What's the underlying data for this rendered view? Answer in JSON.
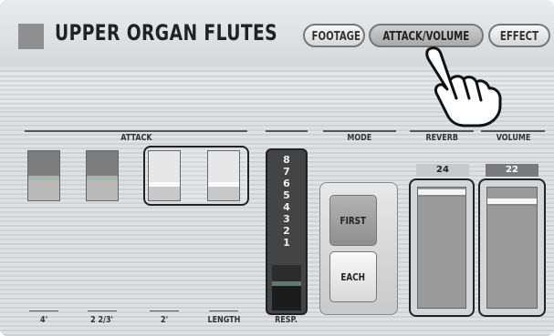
{
  "header": {
    "title": "UPPER ORGAN FLUTES",
    "tabs": [
      {
        "label": "FOOTAGE",
        "active": false
      },
      {
        "label": "ATTACK/VOLUME",
        "active": true
      },
      {
        "label": "EFFECT",
        "active": false
      }
    ]
  },
  "sections": {
    "attack": "ATTACK",
    "mode": "MODE",
    "reverb": "REVERB",
    "volume": "VOLUME"
  },
  "attack_faders": [
    {
      "label": "4'",
      "state": "dark",
      "selected": false
    },
    {
      "label": "2 2/3'",
      "state": "dark",
      "selected": false
    },
    {
      "label": "2'",
      "state": "light",
      "selected": true
    },
    {
      "label": "LENGTH",
      "state": "light",
      "selected": true
    }
  ],
  "resp": {
    "label": "RESP.",
    "scale": [
      "8",
      "7",
      "6",
      "5",
      "4",
      "3",
      "2",
      "1"
    ]
  },
  "mode": {
    "first_label": "FIRST",
    "each_label": "EACH",
    "selected": "FIRST"
  },
  "reverb": {
    "value": "24"
  },
  "volume": {
    "value": "22"
  },
  "colors": {
    "background": "#d0d3d6",
    "frame": "#222222",
    "active_tab": "#b8b8b8",
    "value_box_reverb": "#c9c9c9",
    "value_box_volume": "#7a7a7a"
  },
  "icons": {
    "pointer": "pointing-hand-icon"
  }
}
